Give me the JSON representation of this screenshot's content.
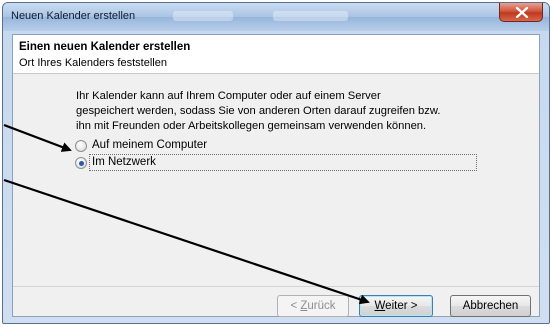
{
  "window": {
    "title": "Neuen Kalender erstellen",
    "close_icon": "close-icon"
  },
  "header": {
    "title": "Einen neuen Kalender erstellen",
    "subtitle": "Ort Ihres Kalenders feststellen"
  },
  "body": {
    "description_lines": [
      "Ihr Kalender kann auf Ihrem Computer oder auf einem Server",
      "gespeichert werden, sodass Sie von anderen Orten darauf zugreifen bzw.",
      "ihn mit Freunden oder Arbeitskollegen gemeinsam verwenden können."
    ],
    "options": [
      {
        "label": "Auf meinem Computer",
        "selected": false
      },
      {
        "label": "Im Netzwerk",
        "selected": true
      }
    ]
  },
  "footer": {
    "back": {
      "prefix": "< ",
      "accel": "Z",
      "rest": "urück",
      "enabled": false
    },
    "next": {
      "accel": "W",
      "rest": "eiter >",
      "default": true
    },
    "cancel": {
      "label": "Abbrechen"
    }
  },
  "colors": {
    "arrow": "#000000",
    "radio_selected": "#2a5aa8"
  }
}
